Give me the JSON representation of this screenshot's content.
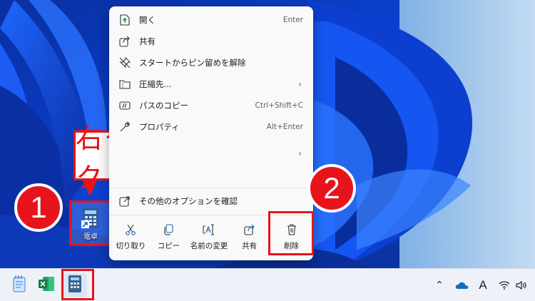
{
  "menu": {
    "items": [
      {
        "label": "開く",
        "shortcut": "Enter",
        "icon": "open-icon"
      },
      {
        "label": "共有",
        "shortcut": "",
        "icon": "share-icon"
      },
      {
        "label": "スタートからピン留めを解除",
        "shortcut": "",
        "icon": "unpin-icon"
      },
      {
        "label": "圧縮先...",
        "shortcut": "",
        "icon": "zip-folder-icon",
        "submenu": true
      },
      {
        "label": "パスのコピー",
        "shortcut": "Ctrl+Shift+C",
        "icon": "copy-path-icon"
      },
      {
        "label": "プロパティ",
        "shortcut": "Alt+Enter",
        "icon": "wrench-icon"
      }
    ],
    "more_options": "その他のオプションを確認",
    "actions": [
      {
        "label": "切り取り",
        "icon": "cut-icon"
      },
      {
        "label": "コピー",
        "icon": "copy-icon"
      },
      {
        "label": "名前の変更",
        "icon": "rename-icon"
      },
      {
        "label": "共有",
        "icon": "share-icon"
      },
      {
        "label": "削除",
        "icon": "delete-icon"
      }
    ]
  },
  "desktop": {
    "shortcut_label": "電卓"
  },
  "callouts": {
    "step1": "1",
    "step2": "2",
    "right_click": "右クリック"
  },
  "taskbar": {
    "apps": [
      "notepad-icon",
      "excel-icon",
      "calculator-icon"
    ],
    "tray": [
      "chevron-up-icon",
      "onedrive-icon",
      "ime-icon",
      "wifi-icon",
      "volume-icon"
    ],
    "ime_text": "A"
  },
  "colors": {
    "accent_red": "#e8141c",
    "menu_bg": "#f9f9f9",
    "taskbar_bg": "#eef2f8"
  }
}
